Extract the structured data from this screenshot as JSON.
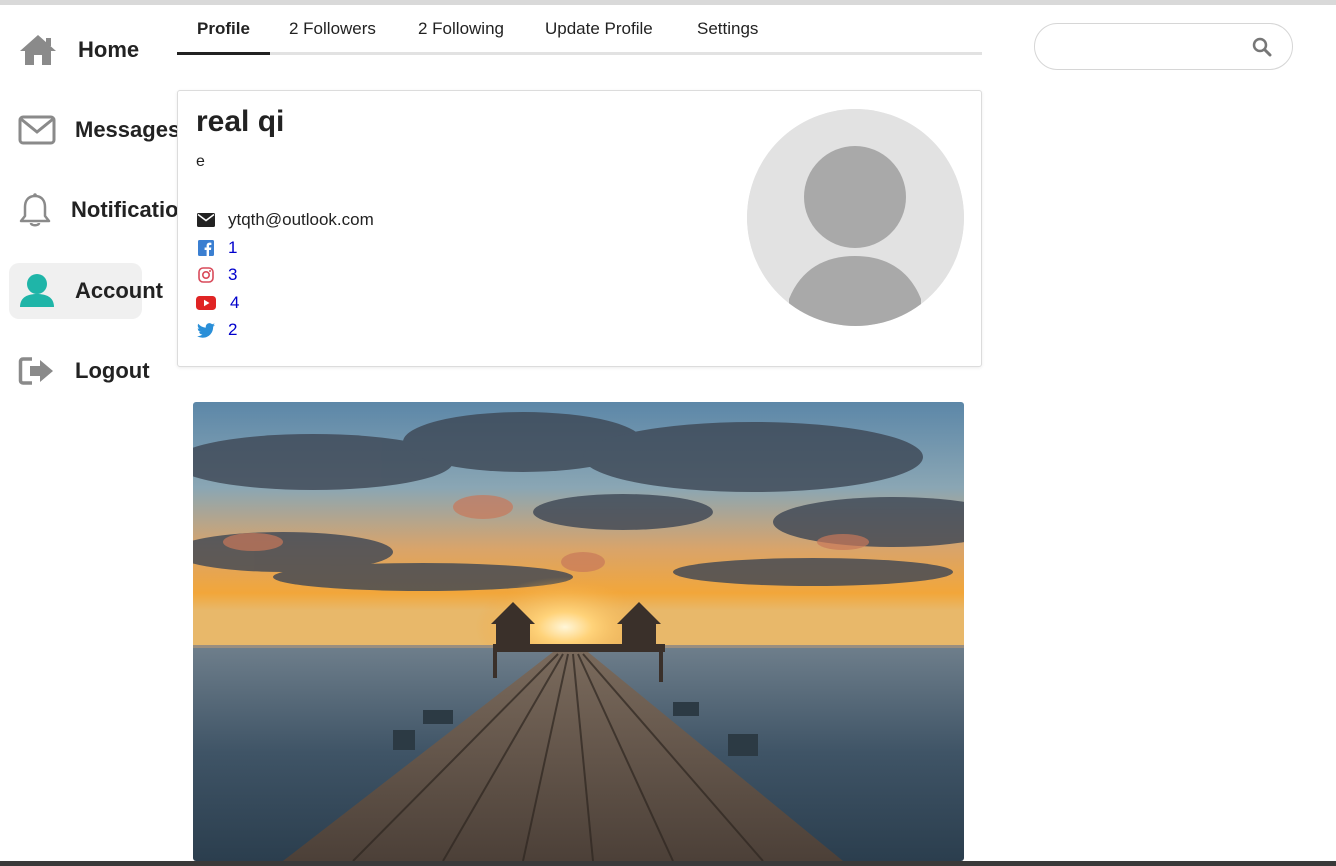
{
  "sidebar": {
    "items": [
      {
        "label": "Home",
        "icon": "home-icon"
      },
      {
        "label": "Messages",
        "icon": "envelope-icon"
      },
      {
        "label": "Notifications",
        "icon": "bell-icon"
      },
      {
        "label": "Account",
        "icon": "user-icon",
        "active": true
      },
      {
        "label": "Logout",
        "icon": "logout-icon"
      }
    ]
  },
  "tabs": [
    {
      "label": "Profile",
      "active": true
    },
    {
      "label": "2 Followers"
    },
    {
      "label": "2 Following"
    },
    {
      "label": "Update Profile"
    },
    {
      "label": "Settings"
    }
  ],
  "search": {
    "placeholder": "",
    "value": ""
  },
  "profile": {
    "name": "real qi",
    "bio": "e",
    "email": "ytqth@outlook.com",
    "facebook": "1",
    "instagram": "3",
    "youtube": "4",
    "twitter": "2"
  },
  "colors": {
    "accent": "#1fb5a8",
    "link": "#0000cc",
    "facebook": "#3b7fd1",
    "instagram": "#d94a5a",
    "youtube": "#e02424",
    "twitter": "#2a8fd8"
  }
}
